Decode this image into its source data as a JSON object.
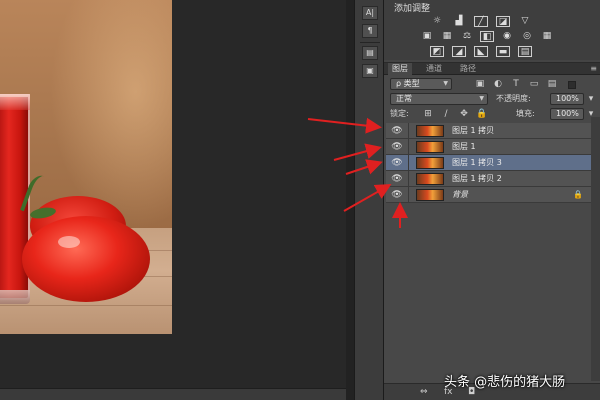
{
  "adjustments": {
    "title": "添加调整",
    "icons": [
      "brightness-icon",
      "levels-icon",
      "curves-icon",
      "exposure-icon",
      "gradient-triangle-icon",
      "vibrance-icon",
      "hue-saturation-icon",
      "color-balance-icon",
      "black-white-icon",
      "photo-filter-icon",
      "channel-mixer-icon",
      "color-lookup-icon",
      "invert-icon",
      "posterize-icon",
      "threshold-icon",
      "gradient-map-icon",
      "selective-color-icon"
    ]
  },
  "tabs": [
    {
      "label": "图层",
      "active": true
    },
    {
      "label": "通道",
      "active": false
    },
    {
      "label": "路径",
      "active": false
    }
  ],
  "filter": {
    "label": "ρ 类型"
  },
  "blend": {
    "mode": "正常",
    "opacity_label": "不透明度:",
    "opacity_value": "100%"
  },
  "lock": {
    "label": "锁定:",
    "fill_label": "填充:",
    "fill_value": "100%"
  },
  "layers": [
    {
      "name": "图层 1 拷贝",
      "selected": false
    },
    {
      "name": "图层 1",
      "selected": false
    },
    {
      "name": "图层 1 拷贝 3",
      "selected": true
    },
    {
      "name": "图层 1 拷贝 2",
      "selected": false
    },
    {
      "name": "背景",
      "selected": false,
      "background": true
    }
  ],
  "bottom_icons": {
    "link": "⇔",
    "fx": "fx",
    "mask": "◘"
  },
  "dock": {
    "btn1": "A|",
    "btn2": "¶",
    "btn3": "▤",
    "btn4": "▣"
  },
  "watermark": "头条 @悲伤的猪大肠",
  "colors": {
    "selected_layer": "#5f6f8a",
    "arrow": "#e02020"
  }
}
